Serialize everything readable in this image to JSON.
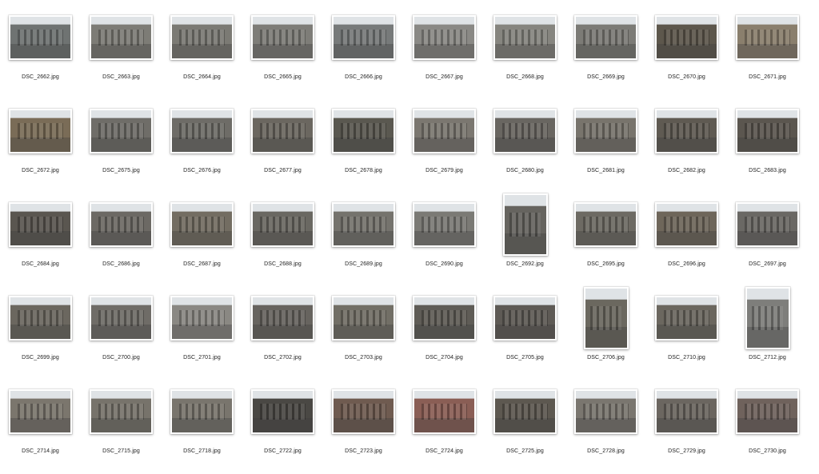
{
  "files": [
    {
      "name": "DSC_2662.jpg",
      "orientation": "landscape",
      "tone": "#6f7372"
    },
    {
      "name": "DSC_2663.jpg",
      "orientation": "landscape",
      "tone": "#7d7c76"
    },
    {
      "name": "DSC_2664.jpg",
      "orientation": "landscape",
      "tone": "#7b7a74"
    },
    {
      "name": "DSC_2665.jpg",
      "orientation": "landscape",
      "tone": "#7e7d78"
    },
    {
      "name": "DSC_2666.jpg",
      "orientation": "landscape",
      "tone": "#777a7a"
    },
    {
      "name": "DSC_2667.jpg",
      "orientation": "landscape",
      "tone": "#8a8985"
    },
    {
      "name": "DSC_2668.jpg",
      "orientation": "landscape",
      "tone": "#86857f"
    },
    {
      "name": "DSC_2669.jpg",
      "orientation": "landscape",
      "tone": "#7c7b76"
    },
    {
      "name": "DSC_2670.jpg",
      "orientation": "landscape",
      "tone": "#5d574c"
    },
    {
      "name": "DSC_2671.jpg",
      "orientation": "landscape",
      "tone": "#8a7f6d"
    },
    {
      "name": "DSC_2672.jpg",
      "orientation": "landscape",
      "tone": "#7a6c57"
    },
    {
      "name": "DSC_2675.jpg",
      "orientation": "landscape",
      "tone": "#6f6d68"
    },
    {
      "name": "DSC_2676.jpg",
      "orientation": "landscape",
      "tone": "#6e6c67"
    },
    {
      "name": "DSC_2677.jpg",
      "orientation": "landscape",
      "tone": "#6b6760"
    },
    {
      "name": "DSC_2678.jpg",
      "orientation": "landscape",
      "tone": "#5a5850"
    },
    {
      "name": "DSC_2679.jpg",
      "orientation": "landscape",
      "tone": "#7b7770"
    },
    {
      "name": "DSC_2680.jpg",
      "orientation": "landscape",
      "tone": "#696661"
    },
    {
      "name": "DSC_2681.jpg",
      "orientation": "landscape",
      "tone": "#78746c"
    },
    {
      "name": "DSC_2682.jpg",
      "orientation": "landscape",
      "tone": "#5f5a52"
    },
    {
      "name": "DSC_2683.jpg",
      "orientation": "landscape",
      "tone": "#5b564f"
    },
    {
      "name": "DSC_2684.jpg",
      "orientation": "landscape",
      "tone": "#5a5650"
    },
    {
      "name": "DSC_2686.jpg",
      "orientation": "landscape",
      "tone": "#6c6964"
    },
    {
      "name": "DSC_2687.jpg",
      "orientation": "landscape",
      "tone": "#736d62"
    },
    {
      "name": "DSC_2688.jpg",
      "orientation": "landscape",
      "tone": "#6a6862"
    },
    {
      "name": "DSC_2689.jpg",
      "orientation": "landscape",
      "tone": "#75736d"
    },
    {
      "name": "DSC_2690.jpg",
      "orientation": "landscape",
      "tone": "#7b7a75"
    },
    {
      "name": "DSC_2692.jpg",
      "orientation": "portrait",
      "tone": "#66645f"
    },
    {
      "name": "DSC_2695.jpg",
      "orientation": "landscape",
      "tone": "#6d6a63"
    },
    {
      "name": "DSC_2696.jpg",
      "orientation": "landscape",
      "tone": "#6e665a"
    },
    {
      "name": "DSC_2697.jpg",
      "orientation": "landscape",
      "tone": "#6a6864"
    },
    {
      "name": "DSC_2699.jpg",
      "orientation": "landscape",
      "tone": "#6b675f"
    },
    {
      "name": "DSC_2700.jpg",
      "orientation": "landscape",
      "tone": "#6f6c67"
    },
    {
      "name": "DSC_2701.jpg",
      "orientation": "landscape",
      "tone": "#8a8883"
    },
    {
      "name": "DSC_2702.jpg",
      "orientation": "landscape",
      "tone": "#67645f"
    },
    {
      "name": "DSC_2703.jpg",
      "orientation": "landscape",
      "tone": "#726f66"
    },
    {
      "name": "DSC_2704.jpg",
      "orientation": "landscape",
      "tone": "#5f5c56"
    },
    {
      "name": "DSC_2705.jpg",
      "orientation": "landscape",
      "tone": "#5e5a55"
    },
    {
      "name": "DSC_2706.jpg",
      "orientation": "portrait",
      "tone": "#6b685f"
    },
    {
      "name": "DSC_2710.jpg",
      "orientation": "landscape",
      "tone": "#6b675f"
    },
    {
      "name": "DSC_2712.jpg",
      "orientation": "portrait",
      "tone": "#7e7e7b"
    },
    {
      "name": "DSC_2714.jpg",
      "orientation": "landscape",
      "tone": "#7b766d"
    },
    {
      "name": "DSC_2715.jpg",
      "orientation": "landscape",
      "tone": "#77736b"
    },
    {
      "name": "DSC_2718.jpg",
      "orientation": "landscape",
      "tone": "#79756d"
    },
    {
      "name": "DSC_2722.jpg",
      "orientation": "landscape",
      "tone": "#4a4844"
    },
    {
      "name": "DSC_2723.jpg",
      "orientation": "landscape",
      "tone": "#6f5b50"
    },
    {
      "name": "DSC_2724.jpg",
      "orientation": "landscape",
      "tone": "#8a5e55"
    },
    {
      "name": "DSC_2725.jpg",
      "orientation": "landscape",
      "tone": "#5d5850"
    },
    {
      "name": "DSC_2728.jpg",
      "orientation": "landscape",
      "tone": "#7a766f"
    },
    {
      "name": "DSC_2729.jpg",
      "orientation": "landscape",
      "tone": "#6b6660"
    },
    {
      "name": "DSC_2730.jpg",
      "orientation": "landscape",
      "tone": "#6f625c"
    }
  ]
}
